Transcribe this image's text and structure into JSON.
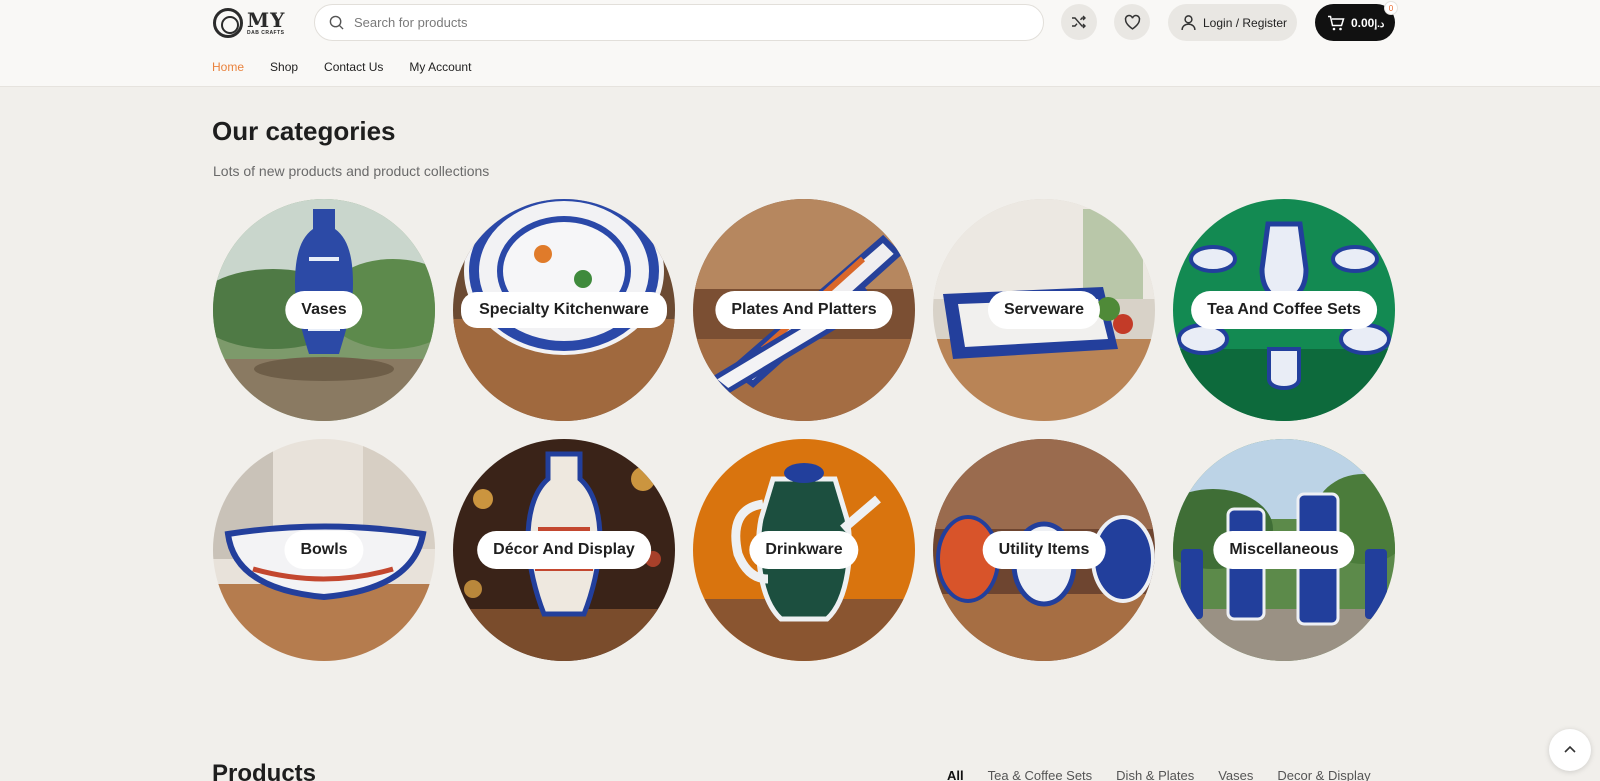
{
  "header": {
    "logo_big": "MY",
    "logo_small": "DAB CRAFTS",
    "search_placeholder": "Search for products",
    "login_label": "Login / Register",
    "cart_total": "0.00",
    "cart_currency": "د.إ",
    "cart_count": "0"
  },
  "nav": {
    "items": [
      {
        "label": "Home",
        "active": true
      },
      {
        "label": "Shop"
      },
      {
        "label": "Contact Us"
      },
      {
        "label": "My Account"
      }
    ]
  },
  "categories": {
    "title": "Our categories",
    "subtitle": "Lots of new products and product collections",
    "items": [
      {
        "label": "Vases",
        "theme": "forest-vase"
      },
      {
        "label": "Specialty Kitchenware",
        "theme": "plate-wood"
      },
      {
        "label": "Plates And Platters",
        "theme": "platter-kitchen"
      },
      {
        "label": "Serveware",
        "theme": "tray-kitchen"
      },
      {
        "label": "Tea And Coffee Sets",
        "theme": "green-teaset"
      },
      {
        "label": "Bowls",
        "theme": "bowl-window"
      },
      {
        "label": "Décor And Display",
        "theme": "vase-bokeh"
      },
      {
        "label": "Drinkware",
        "theme": "orange-teapot"
      },
      {
        "label": "Utility Items",
        "theme": "jars-kitchen"
      },
      {
        "label": "Miscellaneous",
        "theme": "cups-outdoor"
      }
    ]
  },
  "products": {
    "title": "Products",
    "tabs": [
      {
        "label": "All",
        "active": true
      },
      {
        "label": "Tea & Coffee Sets"
      },
      {
        "label": "Dish & Plates"
      },
      {
        "label": "Vases"
      },
      {
        "label": "Decor & Display"
      }
    ]
  },
  "colors": {
    "accent": "#e9833e",
    "cart_bg": "#111111",
    "pottery_blue": "#1f3c8f",
    "page_bg": "#f1efeb"
  }
}
